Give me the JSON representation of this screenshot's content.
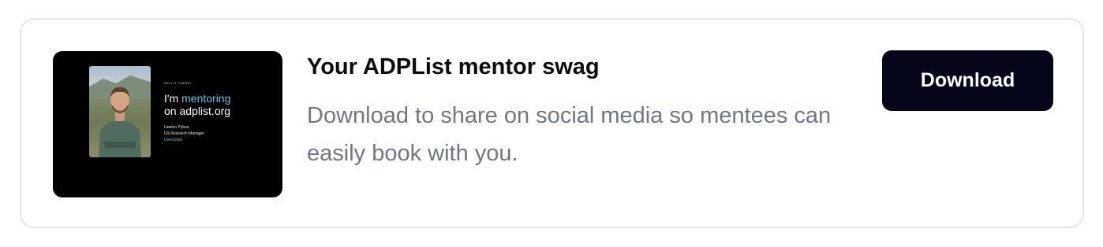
{
  "thumbnail": {
    "hello": "HELLO THERE!",
    "headline_prefix": "I'm ",
    "headline_accent": "mentoring",
    "headline_suffix": "on adplist.org",
    "person_name": "Lawton Pybus",
    "person_role": "UX Research Manager",
    "person_company": "UserZoom"
  },
  "card": {
    "title": "Your ADPList mentor swag",
    "description": "Download to share on social media so mentees can easily book with you.",
    "button_label": "Download"
  },
  "colors": {
    "accent": "#5ec8f2",
    "button_bg": "#06061a",
    "description_text": "#6f7685"
  }
}
